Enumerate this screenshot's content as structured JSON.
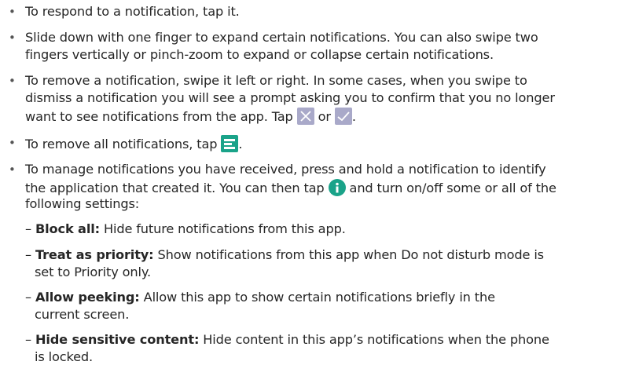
{
  "bullets": [
    {
      "lines": [
        "To respond to a notification, tap it."
      ]
    },
    {
      "lines": [
        "Slide down with one finger to expand certain notifications. You can also swipe two",
        "fingers vertically or pinch-zoom to expand or collapse certain notifications."
      ]
    },
    {
      "lines": [
        "To remove a notification, swipe it left or right. In some cases, when you swipe to",
        "dismiss a notification you will see a prompt asking you to confirm that you no longer",
        "want to see notifications from the app. Tap",
        "or",
        "."
      ]
    },
    {
      "lines": [
        "To remove all notifications, tap",
        "."
      ]
    },
    {
      "lines": [
        "To manage notifications you have received, press and hold a notification to identify",
        "the application that created it. You can then tap",
        "and turn on/off some or all of the",
        "following settings:"
      ]
    }
  ],
  "settings": [
    {
      "name": "Block all:",
      "desc": [
        "Hide future notifications from this app."
      ]
    },
    {
      "name": "Treat as priority:",
      "desc": [
        "Show notifications from this app when Do not disturb mode is",
        "set to Priority only."
      ]
    },
    {
      "name": "Allow peeking:",
      "desc": [
        "Allow this app to show certain notifications briefly in the",
        "current screen."
      ]
    },
    {
      "name": "Hide sensitive content:",
      "desc": [
        "Hide content in this app’s notifications when the phone",
        "is locked."
      ]
    }
  ],
  "dash": "–",
  "bullet_char": "•",
  "icons": {
    "cancel": "close-x-icon",
    "confirm": "check-icon",
    "clear_all": "clear-all-icon",
    "info": "info-icon",
    "icon_color": "#a9a9c9",
    "clear_all_color": "#1aa389",
    "info_color": "#1aa389"
  }
}
